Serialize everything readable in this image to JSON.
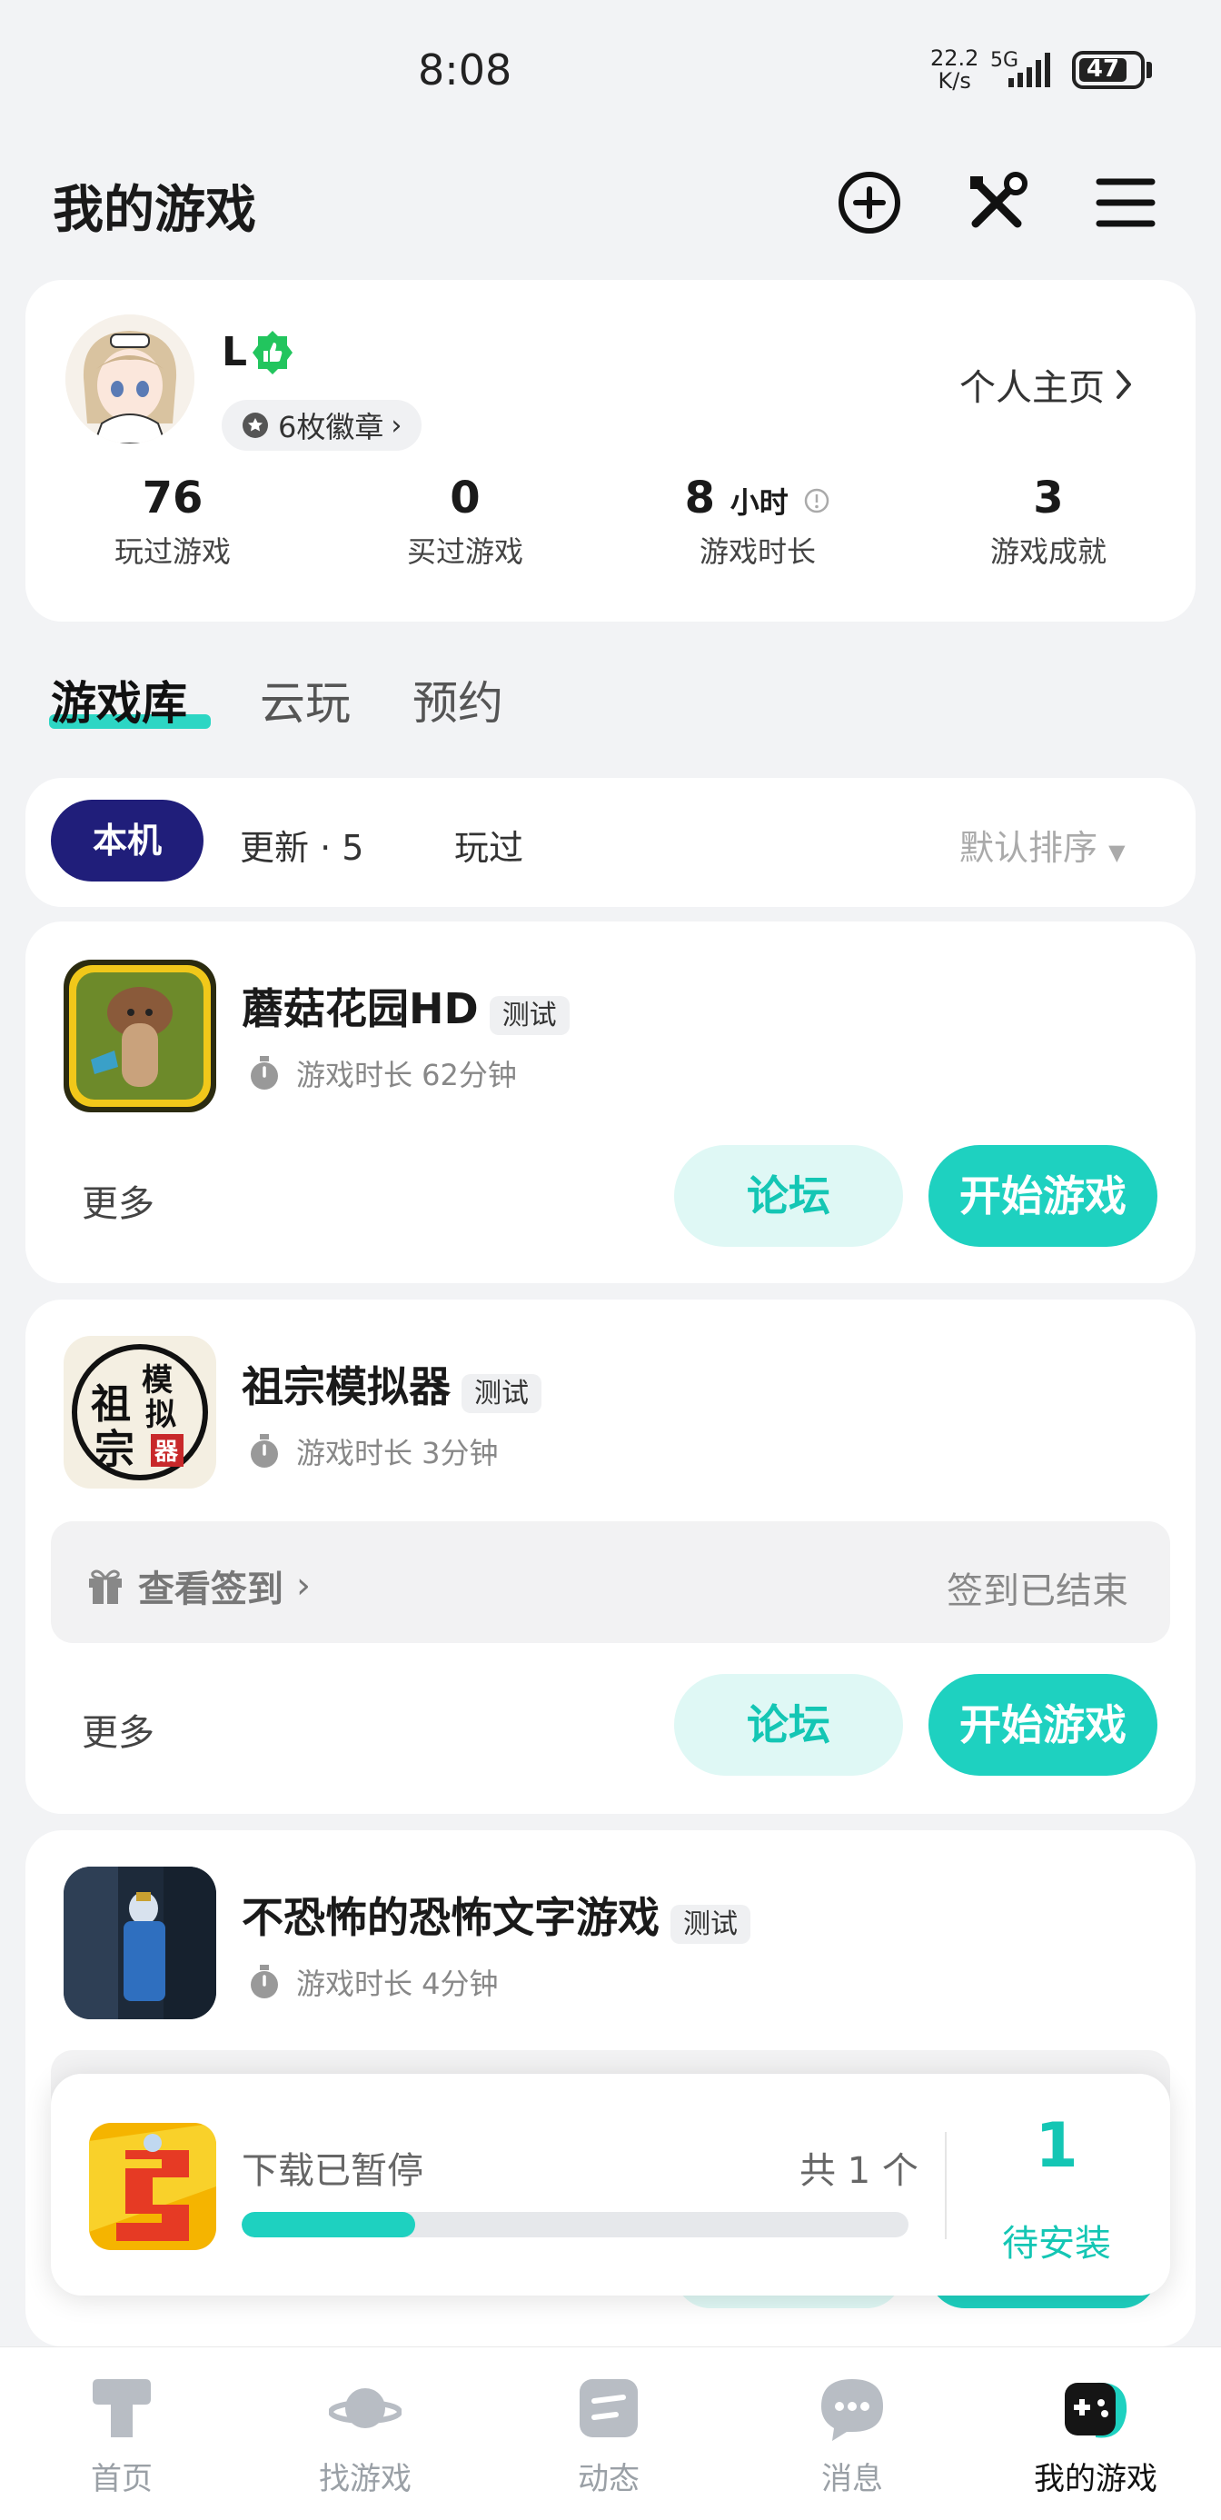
{
  "status_bar": {
    "time": "8:08",
    "speed_value": "22.2",
    "speed_unit": "K/s",
    "network": "5G",
    "battery": "47"
  },
  "header": {
    "title": "我的游戏",
    "icons": [
      "add-circle-icon",
      "tools-icon",
      "menu-icon"
    ]
  },
  "profile": {
    "username": "L",
    "badges": "6枚徽章",
    "homepage_link": "个人主页",
    "stats": [
      {
        "value": "76",
        "label": "玩过游戏"
      },
      {
        "value": "0",
        "label": "买过游戏"
      },
      {
        "value": "8",
        "unit": "小时",
        "label": "游戏时长"
      },
      {
        "value": "3",
        "label": "游戏成就"
      }
    ]
  },
  "library_tabs": [
    {
      "label": "游戏库",
      "active": true
    },
    {
      "label": "云玩",
      "active": false
    },
    {
      "label": "预约",
      "active": false
    }
  ],
  "filters": {
    "items": [
      "本机",
      "更新 · 5",
      "玩过"
    ],
    "active": "本机",
    "sort": "默认排序"
  },
  "games": [
    {
      "name": "蘑菇花园HD",
      "tag": "测试",
      "playtime": "游戏时长 62分钟",
      "more": "更多",
      "forum": "论坛",
      "start": "开始游戏"
    },
    {
      "name": "祖宗模拟器",
      "tag": "测试",
      "playtime": "游戏时长 3分钟",
      "signin_link": "查看签到",
      "signin_status": "签到已结束",
      "more": "更多",
      "forum": "论坛",
      "start": "开始游戏",
      "icon_text": [
        "祖",
        "宗",
        "模",
        "拟",
        "器"
      ]
    },
    {
      "name": "不恐怖的恐怖文字游戏",
      "tag": "测试",
      "playtime": "游戏时长 4分钟"
    }
  ],
  "download": {
    "status": "下载已暂停",
    "count": "共 1 个",
    "progress": 0.26,
    "pending_number": "1",
    "pending_label": "待安装"
  },
  "bottom_nav": [
    {
      "label": "首页",
      "active": false
    },
    {
      "label": "找游戏",
      "active": false
    },
    {
      "label": "动态",
      "active": false
    },
    {
      "label": "消息",
      "active": false
    },
    {
      "label": "我的游戏",
      "active": true
    }
  ],
  "colors": {
    "accent": "#1ed1c0",
    "accent_light": "#dff8f5",
    "filter_active": "#201e7a",
    "page_bg": "#f2f3f5",
    "profile_badge": "#22c55e"
  }
}
